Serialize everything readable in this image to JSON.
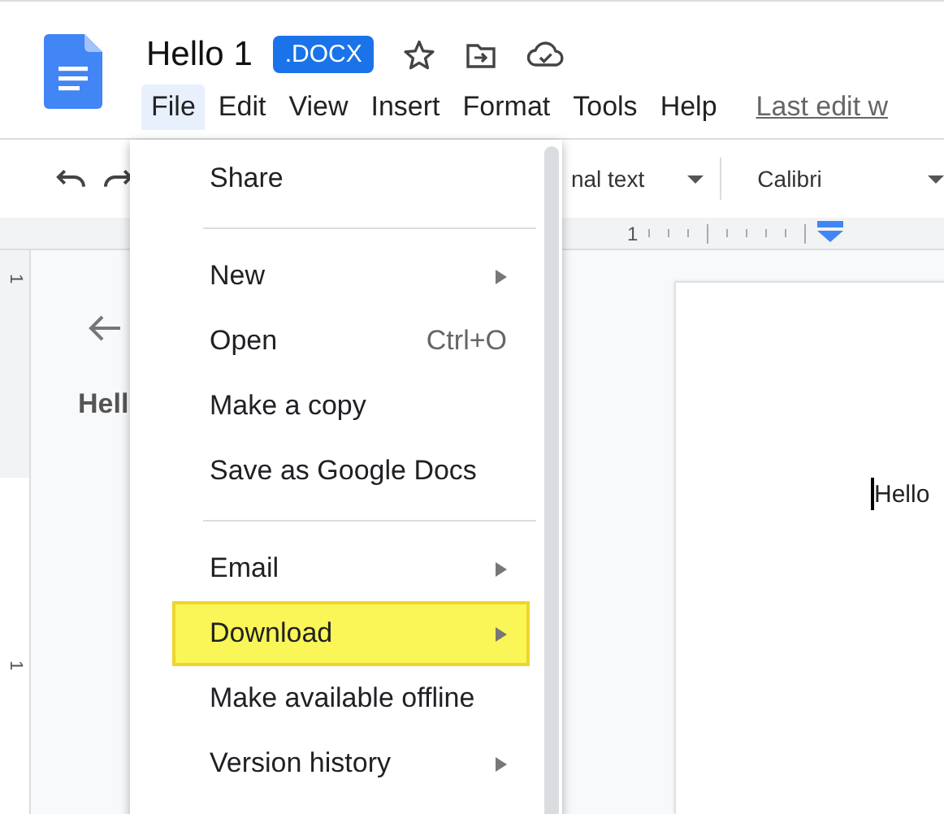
{
  "document": {
    "title": "Hello 1",
    "badge": ".DOCX"
  },
  "menubar": [
    {
      "label": "File",
      "selected": true
    },
    {
      "label": "Edit",
      "selected": false
    },
    {
      "label": "View",
      "selected": false
    },
    {
      "label": "Insert",
      "selected": false
    },
    {
      "label": "Format",
      "selected": false
    },
    {
      "label": "Tools",
      "selected": false
    },
    {
      "label": "Help",
      "selected": false
    }
  ],
  "last_edit": "Last edit w",
  "toolbar": {
    "style": "nal text",
    "font": "Calibri"
  },
  "ruler": {
    "mark": "1"
  },
  "vertical_ruler": {
    "marks": [
      "1",
      "1"
    ]
  },
  "outline": {
    "heading": "Hell"
  },
  "page": {
    "text": "Hello"
  },
  "file_menu": {
    "items": [
      {
        "kind": "item",
        "label": "Share",
        "submenu": false,
        "selected": false
      },
      {
        "kind": "separator"
      },
      {
        "kind": "item",
        "label": "New",
        "submenu": true,
        "selected": false
      },
      {
        "kind": "item",
        "label": "Open",
        "shortcut": "Ctrl+O",
        "submenu": false,
        "selected": false
      },
      {
        "kind": "item",
        "label": "Make a copy",
        "submenu": false,
        "selected": false
      },
      {
        "kind": "item",
        "label": "Save as Google Docs",
        "submenu": false,
        "selected": false
      },
      {
        "kind": "separator"
      },
      {
        "kind": "item",
        "label": "Email",
        "submenu": true,
        "selected": false
      },
      {
        "kind": "item",
        "label": "Download",
        "submenu": true,
        "selected": true
      },
      {
        "kind": "item",
        "label": "Make available offline",
        "submenu": false,
        "selected": false
      },
      {
        "kind": "item",
        "label": "Version history",
        "submenu": true,
        "selected": false
      }
    ]
  }
}
